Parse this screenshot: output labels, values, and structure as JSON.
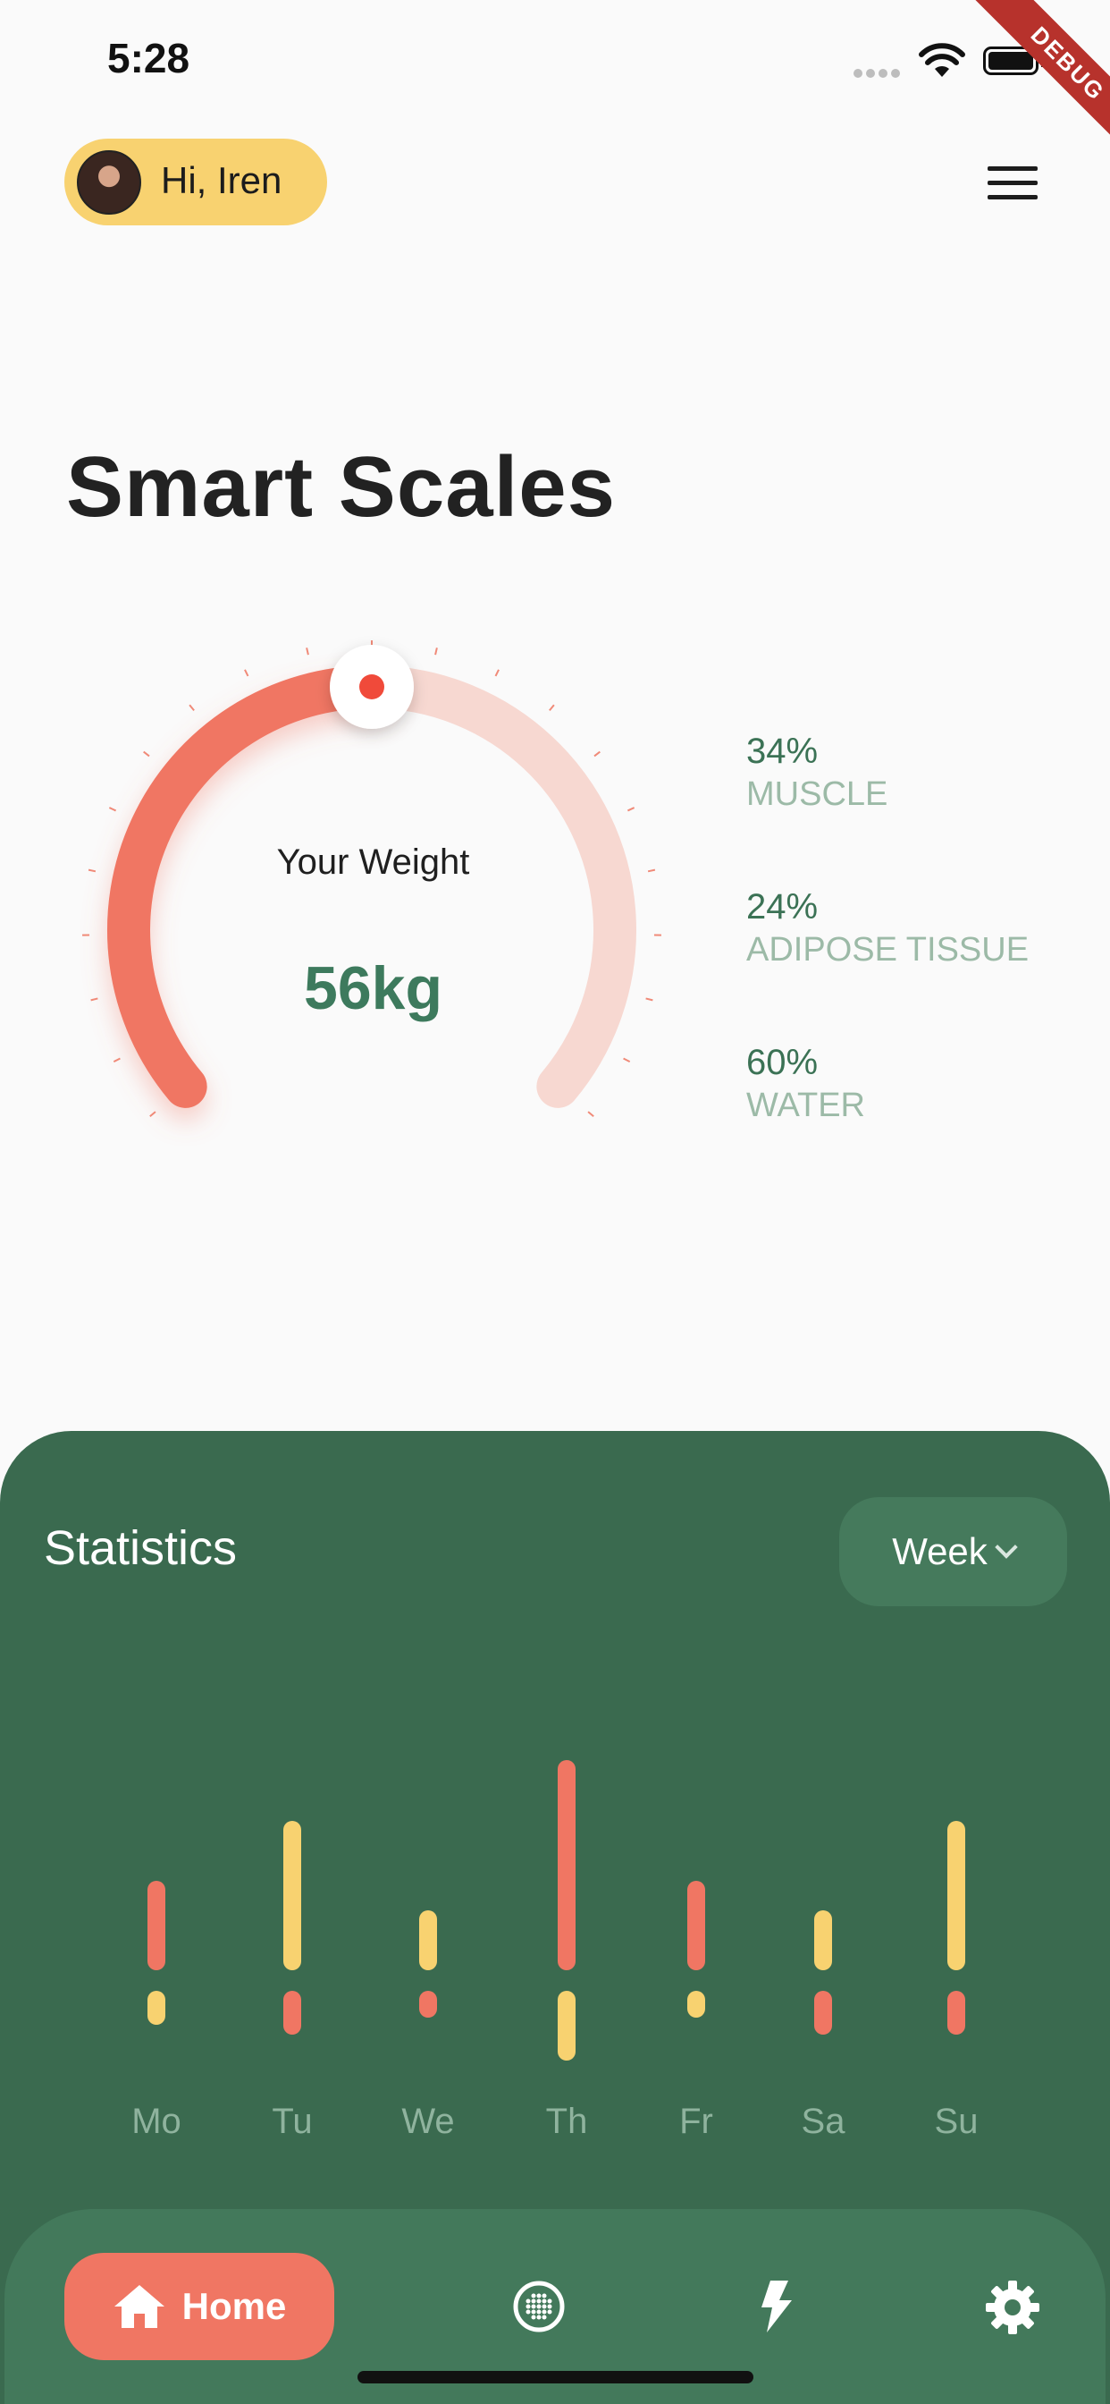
{
  "status_bar": {
    "time": "5:28"
  },
  "debug_banner": "DEBUG",
  "header": {
    "greeting": "Hi, Iren",
    "avatar": "user-avatar",
    "menu_icon": "hamburger-menu-icon"
  },
  "page_title": "Smart Scales",
  "weight": {
    "label": "Your Weight",
    "value": "56kg",
    "gauge_fraction": 0.5
  },
  "composition": [
    {
      "percent": "34%",
      "label": "MUSCLE"
    },
    {
      "percent": "24%",
      "label": "ADIPOSE TISSUE"
    },
    {
      "percent": "60%",
      "label": "WATER"
    }
  ],
  "statistics": {
    "title": "Statistics",
    "period": "Week",
    "days": [
      "Mo",
      "Tu",
      "We",
      "Th",
      "Fr",
      "Sa",
      "Su"
    ]
  },
  "colors": {
    "accent_red": "#f07663",
    "accent_yellow": "#f8d270",
    "green_dark": "#3a6a4f",
    "green_text": "#3d7a5d"
  },
  "nav": {
    "home_label": "Home",
    "items": [
      "home-icon",
      "globe-icon",
      "lightning-icon",
      "settings-gear-icon"
    ]
  }
}
